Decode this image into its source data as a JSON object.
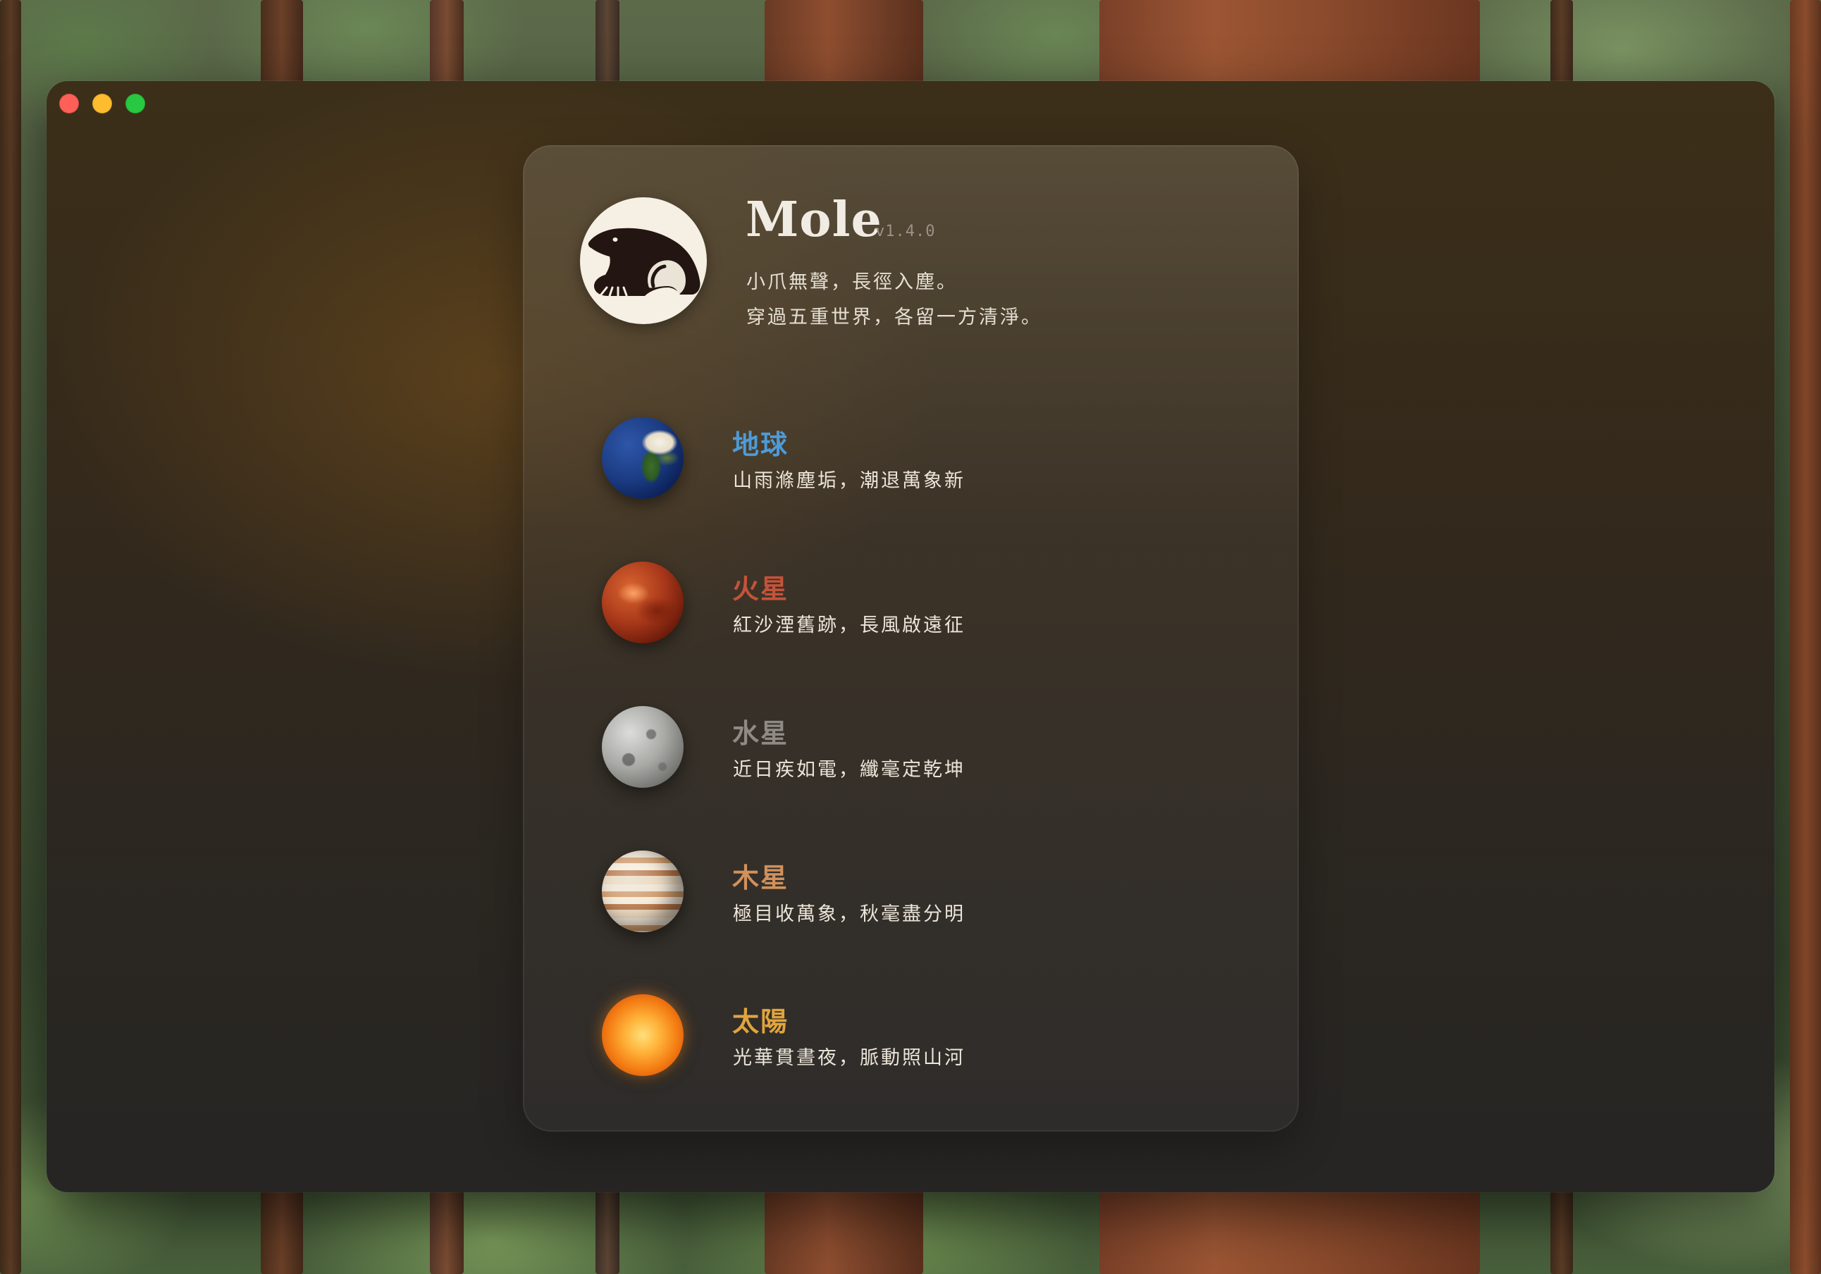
{
  "app": {
    "name": "Mole",
    "version": "v1.4.0",
    "tagline": [
      "小爪無聲，長徑入塵。",
      "穿過五重世界，各留一方清淨。"
    ]
  },
  "window": {
    "controls": [
      "close",
      "minimize",
      "zoom"
    ],
    "control_colors": {
      "close": "#fe5f57",
      "minimize": "#febc2e",
      "zoom": "#28c840"
    }
  },
  "planets": [
    {
      "name": "地球",
      "motto": "山雨滌塵垢，潮退萬象新",
      "color": "#4d9bd8",
      "icon": "earth-icon"
    },
    {
      "name": "火星",
      "motto": "紅沙湮舊跡，長風啟遠征",
      "color": "#c4533a",
      "icon": "mars-icon"
    },
    {
      "name": "水星",
      "motto": "近日疾如電，纖毫定乾坤",
      "color": "#8f8a84",
      "icon": "mercury-icon"
    },
    {
      "name": "木星",
      "motto": "極目收萬象，秋毫盡分明",
      "color": "#d0915c",
      "icon": "jupiter-icon"
    },
    {
      "name": "太陽",
      "motto": "光華貫晝夜，脈動照山河",
      "color": "#e0a43c",
      "icon": "sun-icon"
    }
  ]
}
